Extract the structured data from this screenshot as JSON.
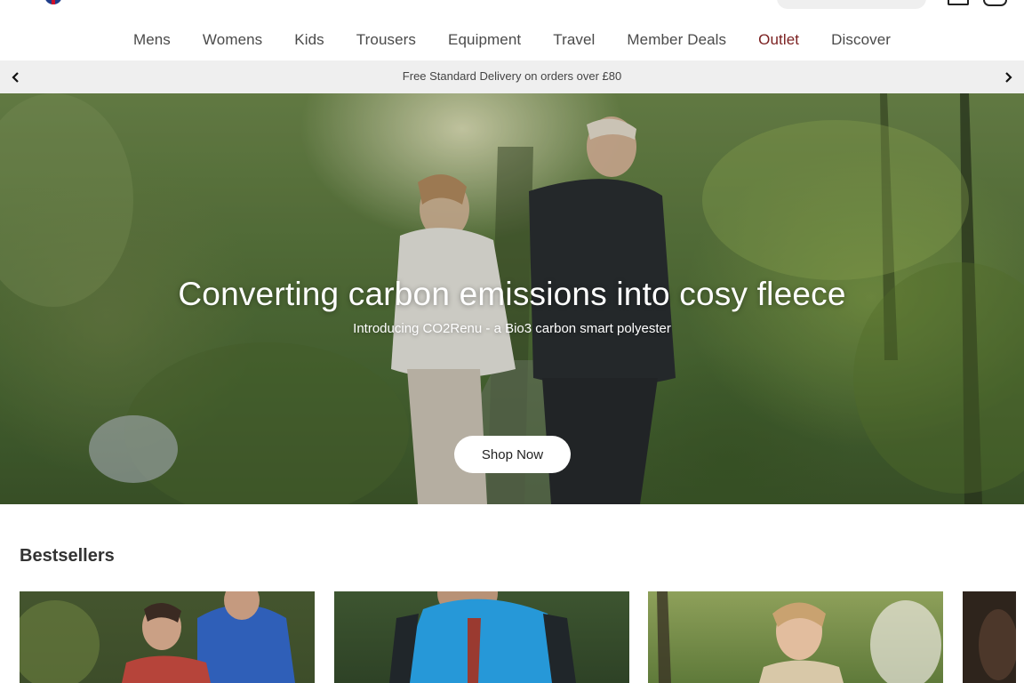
{
  "header": {
    "flag_icon": "uk-flag-icon",
    "logo_icon": "brand-logo",
    "search_icon": "search-icon",
    "account_icon": "account-icon",
    "bag_icon": "shopping-bag-icon"
  },
  "nav": {
    "items": [
      {
        "label": "Mens"
      },
      {
        "label": "Womens"
      },
      {
        "label": "Kids"
      },
      {
        "label": "Trousers"
      },
      {
        "label": "Equipment"
      },
      {
        "label": "Travel"
      },
      {
        "label": "Member Deals"
      },
      {
        "label": "Outlet"
      },
      {
        "label": "Discover"
      }
    ],
    "outlet_color": "#7a1f1f"
  },
  "promo": {
    "message": "Free Standard Delivery on orders over £80",
    "prev_icon": "chevron-left-icon",
    "next_icon": "chevron-right-icon",
    "background": "#efefef"
  },
  "hero": {
    "headline": "Converting carbon emissions into cosy fleece",
    "subline": "Introducing CO2Renu - a Bio3 carbon smart polyester",
    "cta_label": "Shop Now"
  },
  "bestsellers": {
    "title": "Bestsellers",
    "cards": [
      {
        "image": "couple-blue-jacket-photo"
      },
      {
        "image": "man-blue-puffer-photo"
      },
      {
        "image": "woman-forest-photo"
      },
      {
        "image": "partial-product-photo"
      }
    ]
  }
}
